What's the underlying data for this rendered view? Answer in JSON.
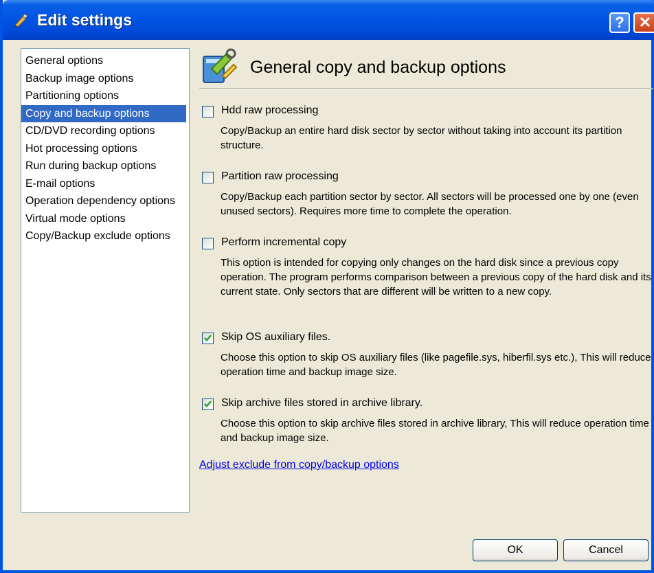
{
  "window": {
    "title": "Edit settings",
    "help_label": "?",
    "close_label": "✕"
  },
  "nav": {
    "items": [
      {
        "label": "General options",
        "selected": false
      },
      {
        "label": "Backup image options",
        "selected": false
      },
      {
        "label": "Partitioning options",
        "selected": false
      },
      {
        "label": "Copy and backup options",
        "selected": true
      },
      {
        "label": "CD/DVD recording options",
        "selected": false
      },
      {
        "label": "Hot processing options",
        "selected": false
      },
      {
        "label": "Run during backup options",
        "selected": false
      },
      {
        "label": "E-mail options",
        "selected": false
      },
      {
        "label": "Operation dependency options",
        "selected": false
      },
      {
        "label": "Virtual mode options",
        "selected": false
      },
      {
        "label": "Copy/Backup exclude options",
        "selected": false
      }
    ]
  },
  "main": {
    "title": "General copy and backup options",
    "options": [
      {
        "label": "Hdd raw processing",
        "checked": false,
        "description": "Copy/Backup an entire hard disk sector by sector without taking into account its partition structure."
      },
      {
        "label": "Partition raw processing",
        "checked": false,
        "description": "Copy/Backup each partition sector by sector. All sectors will be processed one by one (even unused sectors). Requires more time to complete the operation."
      },
      {
        "label": "Perform incremental copy",
        "checked": false,
        "description": "This option is intended for copying only changes on the hard disk since a previous copy operation. The program performs comparison between a previous copy of the hard disk and its current state. Only sectors that are different will be written to a new copy."
      },
      {
        "label": "Skip OS auxiliary files.",
        "checked": true,
        "description": "Choose this option to skip OS auxiliary files (like pagefile.sys, hiberfil.sys etc.), This will reduce operation time and backup image size."
      },
      {
        "label": "Skip archive files stored in archive library.",
        "checked": true,
        "description": "Choose this option to skip archive files stored in archive library, This will reduce operation time and backup image size."
      }
    ],
    "link": "Adjust exclude from copy/backup options"
  },
  "buttons": {
    "ok": "OK",
    "cancel": "Cancel"
  }
}
